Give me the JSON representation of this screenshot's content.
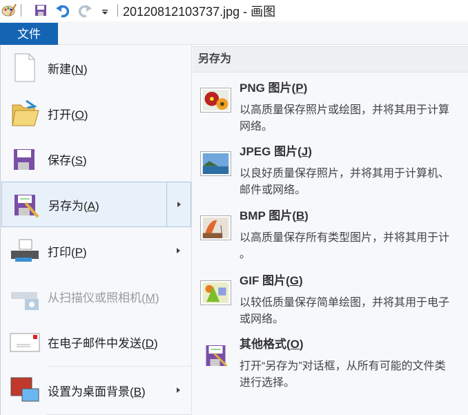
{
  "titlebar": {
    "title": "20120812103737.jpg - 画图"
  },
  "ribbon": {
    "file_tab": "文件"
  },
  "menu": {
    "items": [
      {
        "label": "新建(",
        "key": "N",
        "end": ")"
      },
      {
        "label": "打开(",
        "key": "O",
        "end": ")"
      },
      {
        "label": "保存(",
        "key": "S",
        "end": ")"
      },
      {
        "label": "另存为(",
        "key": "A",
        "end": ")"
      },
      {
        "label": "打印(",
        "key": "P",
        "end": ")"
      },
      {
        "label": "从扫描仪或照相机(",
        "key": "M",
        "end": ")"
      },
      {
        "label": "在电子邮件中发送(",
        "key": "D",
        "end": ")"
      },
      {
        "label": "设置为桌面背景(",
        "key": "B",
        "end": ")"
      }
    ]
  },
  "saveas": {
    "header": "另存为",
    "entries": [
      {
        "title": "PNG 图片(",
        "key": "P",
        "end": ")",
        "line1": "以高质量保存照片或绘图，并将其用于计算",
        "line2": "网络。"
      },
      {
        "title": "JPEG 图片(",
        "key": "J",
        "end": ")",
        "line1": "以良好质量保存照片，并将其用于计算机、",
        "line2": "邮件或网络。"
      },
      {
        "title": "BMP 图片(",
        "key": "B",
        "end": ")",
        "line1": "以高质量保存所有类型图片，并将其用于计",
        "line2": "。"
      },
      {
        "title": "GIF 图片(",
        "key": "G",
        "end": ")",
        "line1": "以较低质量保存简单绘图，并将其用于电子",
        "line2": "或网络。"
      },
      {
        "title": "其他格式(",
        "key": "O",
        "end": ")",
        "line1": "打开“另存为”对话框，从所有可能的文件类",
        "line2": "进行选择。"
      }
    ]
  },
  "colors": {
    "accent": "#1464b4",
    "highlight": "#e8f0f9"
  }
}
